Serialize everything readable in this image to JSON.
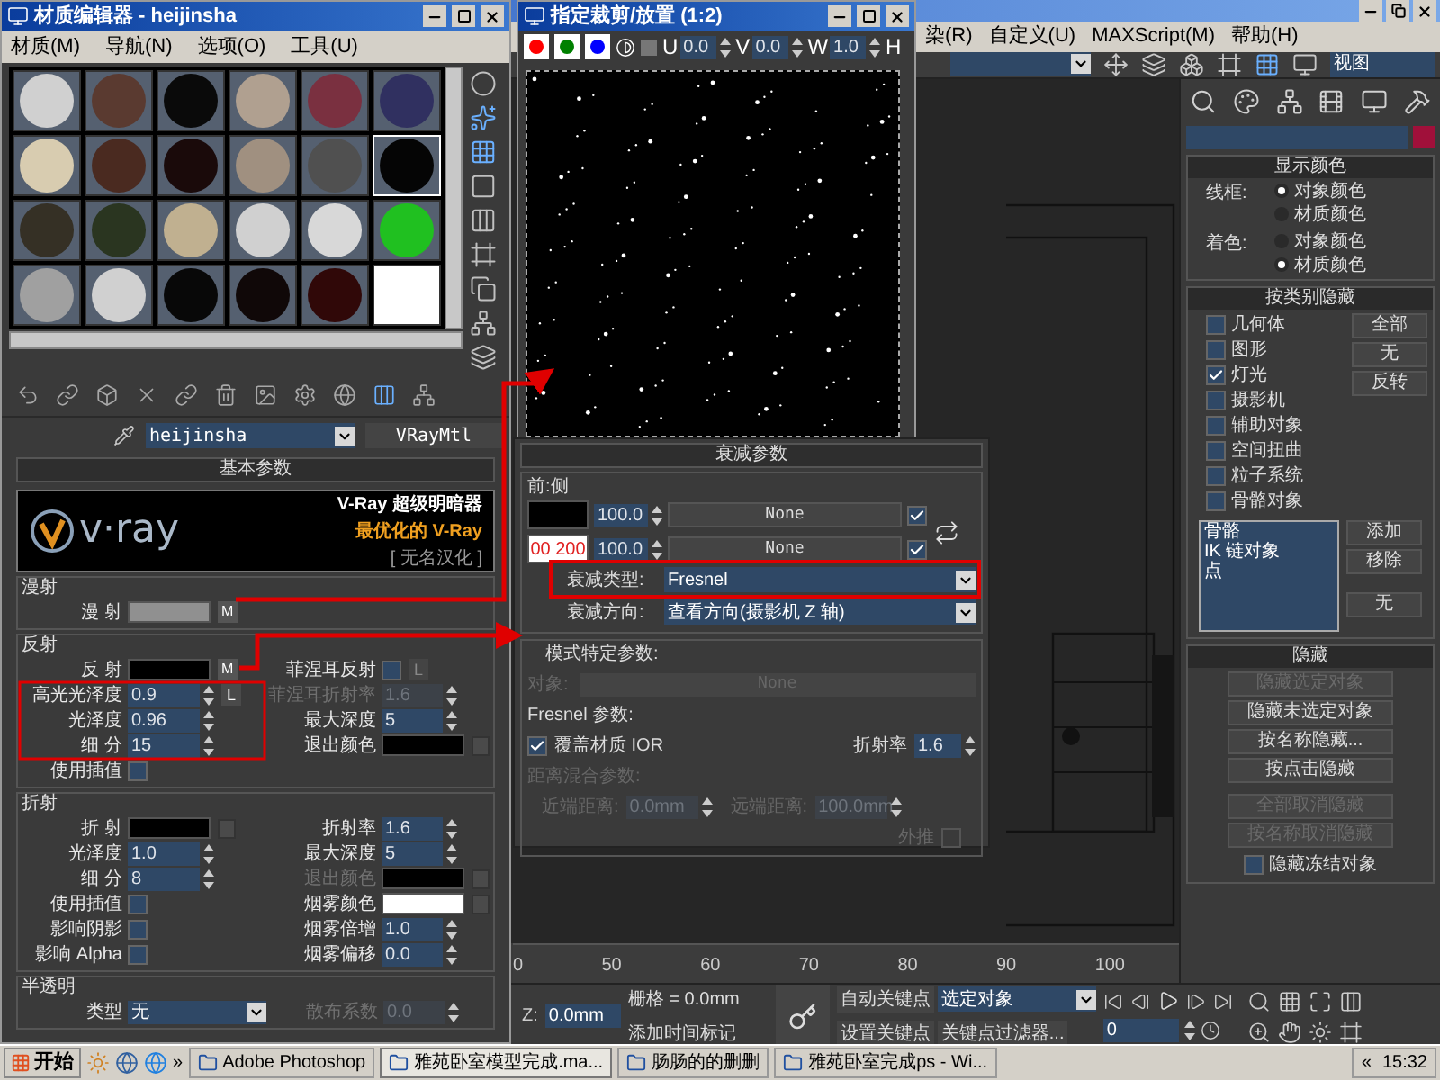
{
  "main_window": {
    "menu": [
      {
        "label": "染(R)"
      },
      {
        "label": "自定义(U)"
      },
      {
        "label": "MAXScript(M)"
      },
      {
        "label": "帮助(H)"
      }
    ],
    "view_selector": "视图",
    "timeline_ticks": [
      "0",
      "50",
      "60",
      "70",
      "80",
      "90",
      "100"
    ],
    "status": {
      "z_label": "Z:",
      "z_value": "0.0mm",
      "grid": "栅格 = 0.0mm",
      "add_time_tag": "添加时间标记",
      "auto_key": "自动关键点",
      "key_mode": "选定对象",
      "set_key": "设置关键点",
      "key_filters": "关键点过滤器...",
      "frame": "0"
    }
  },
  "command_panel": {
    "object_swatch": {
      "color": "#a0103a"
    },
    "display_color": {
      "title": "显示颜色",
      "groups": [
        {
          "label": "线框:",
          "options": [
            {
              "label": "对象颜色",
              "selected": true
            },
            {
              "label": "材质颜色",
              "selected": false
            }
          ]
        },
        {
          "label": "着色:",
          "options": [
            {
              "label": "对象颜色",
              "selected": false
            },
            {
              "label": "材质颜色",
              "selected": true
            }
          ]
        }
      ]
    },
    "hide_by_category": {
      "title": "按类别隐藏",
      "categories": [
        {
          "label": "几何体",
          "checked": false
        },
        {
          "label": "图形",
          "checked": false
        },
        {
          "label": "灯光",
          "checked": true
        },
        {
          "label": "摄影机",
          "checked": false
        },
        {
          "label": "辅助对象",
          "checked": false
        },
        {
          "label": "空间扭曲",
          "checked": false
        },
        {
          "label": "粒子系统",
          "checked": false
        },
        {
          "label": "骨骼对象",
          "checked": false
        }
      ],
      "buttons": [
        "全部",
        "无",
        "反转"
      ],
      "list": [
        "骨骼",
        "IK 链对象",
        "点"
      ],
      "list_buttons": [
        "添加",
        "移除",
        "无"
      ]
    },
    "hide": {
      "title": "隐藏",
      "buttons": [
        {
          "label": "隐藏选定对象",
          "disabled": true
        },
        {
          "label": "隐藏未选定对象",
          "disabled": false
        },
        {
          "label": "按名称隐藏...",
          "disabled": false
        },
        {
          "label": "按点击隐藏",
          "disabled": false
        },
        {
          "label": "全部取消隐藏",
          "disabled": true
        },
        {
          "label": "按名称取消隐藏",
          "disabled": true
        }
      ],
      "freeze_option": {
        "label": "隐藏冻结对象",
        "checked": false
      }
    }
  },
  "material_editor": {
    "title": "材质编辑器 - heijinsha",
    "menu": [
      "材质(M)",
      "导航(N)",
      "选项(O)",
      "工具(U)"
    ],
    "slots": [
      {
        "kind": "sphere",
        "color": "#d0d0d0",
        "selected": false
      },
      {
        "kind": "sphere",
        "color": "#5a3a30",
        "selected": false
      },
      {
        "kind": "sphere",
        "color": "#0a0a0a",
        "selected": false
      },
      {
        "kind": "sphere",
        "color": "#b0a090",
        "selected": false
      },
      {
        "kind": "sphere",
        "color": "#7a3040",
        "selected": false
      },
      {
        "kind": "sphere",
        "color": "#303060",
        "selected": false
      },
      {
        "kind": "sphere",
        "color": "#d8ccb0",
        "selected": false
      },
      {
        "kind": "sphere",
        "color": "#4a2a20",
        "selected": false
      },
      {
        "kind": "sphere",
        "color": "#1a0a0a",
        "selected": false
      },
      {
        "kind": "sphere",
        "color": "#a09080",
        "selected": false
      },
      {
        "kind": "sphere",
        "color": "#505050",
        "selected": false
      },
      {
        "kind": "sphere",
        "color": "#050505",
        "selected": true
      },
      {
        "kind": "sphere",
        "color": "#353025",
        "selected": false
      },
      {
        "kind": "sphere",
        "color": "#2a3520",
        "selected": false
      },
      {
        "kind": "sphere",
        "color": "#c0b090",
        "selected": false
      },
      {
        "kind": "sphere",
        "color": "#d0d0d0",
        "selected": false
      },
      {
        "kind": "sphere",
        "color": "#d8d8d8",
        "selected": false
      },
      {
        "kind": "sphere",
        "color": "#20c020",
        "selected": false
      },
      {
        "kind": "sphere",
        "color": "#a0a0a0",
        "selected": false
      },
      {
        "kind": "sphere",
        "color": "#d0d0d0",
        "selected": false
      },
      {
        "kind": "sphere",
        "color": "#080808",
        "selected": false
      },
      {
        "kind": "sphere",
        "color": "#100808",
        "selected": false
      },
      {
        "kind": "sphere",
        "color": "#300808",
        "selected": false
      },
      {
        "kind": "blank",
        "color": "#ffffff",
        "selected": false
      }
    ],
    "material_name": "heijinsha",
    "material_type": "VRayMtl",
    "rollout": "基本参数",
    "banner": {
      "logo": "v·ray",
      "line1": "V-Ray 超级明暗器",
      "line2": "最优化的 V-Ray",
      "line3": "[ 无名汉化 ]"
    },
    "sections": [
      {
        "title": "漫射",
        "left": [
          {
            "kind": "color",
            "label": "漫 射",
            "color": "#909090",
            "map": "M",
            "disabled": false
          }
        ]
      },
      {
        "title": "反射",
        "left": [
          {
            "kind": "color",
            "label": "反 射",
            "color": "#000000",
            "map": "M",
            "disabled": false
          },
          {
            "kind": "spinner",
            "label": "高光光泽度",
            "value": "0.9",
            "lock": "L",
            "disabled": false
          },
          {
            "kind": "spinner",
            "label": "光泽度",
            "value": "0.96",
            "disabled": false
          },
          {
            "kind": "spinner",
            "label": "细 分",
            "value": "15",
            "disabled": false
          },
          {
            "kind": "checkbox",
            "label": "使用插值",
            "checked": false,
            "disabled": false
          }
        ],
        "right": [
          {
            "kind": "checkbox",
            "label": "菲涅耳反射",
            "checked": false,
            "lock": "L",
            "disabled": false
          },
          {
            "kind": "spinner",
            "label": "菲涅耳折射率",
            "value": "1.6",
            "disabled": true
          },
          {
            "kind": "spinner",
            "label": "最大深度",
            "value": "5",
            "disabled": false
          },
          {
            "kind": "color",
            "label": "退出颜色",
            "color": "#000000",
            "disabled": false
          }
        ]
      },
      {
        "title": "折射",
        "left": [
          {
            "kind": "color",
            "label": "折 射",
            "color": "#000000",
            "disabled": false
          },
          {
            "kind": "spinner",
            "label": "光泽度",
            "value": "1.0",
            "disabled": false
          },
          {
            "kind": "spinner",
            "label": "细 分",
            "value": "8",
            "disabled": false
          },
          {
            "kind": "checkbox",
            "label": "使用插值",
            "checked": false,
            "disabled": false
          },
          {
            "kind": "checkbox",
            "label": "影响阴影",
            "checked": false,
            "disabled": false
          },
          {
            "kind": "checkbox",
            "label": "影响 Alpha",
            "checked": false,
            "disabled": false
          }
        ],
        "right": [
          {
            "kind": "spinner",
            "label": "折射率",
            "value": "1.6",
            "disabled": false
          },
          {
            "kind": "spinner",
            "label": "最大深度",
            "value": "5",
            "disabled": false
          },
          {
            "kind": "color",
            "label": "退出颜色",
            "color": "#000000",
            "disabled": true
          },
          {
            "kind": "color",
            "label": "烟雾颜色",
            "color": "#ffffff",
            "disabled": false
          },
          {
            "kind": "spinner",
            "label": "烟雾倍增",
            "value": "1.0",
            "disabled": false
          },
          {
            "kind": "spinner",
            "label": "烟雾偏移",
            "value": "0.0",
            "disabled": false
          }
        ]
      },
      {
        "title": "半透明",
        "left": [
          {
            "kind": "dropdown",
            "label": "类型",
            "value": "无",
            "disabled": false
          }
        ],
        "right": [
          {
            "kind": "spinner",
            "label": "散布系数",
            "value": "0.0",
            "disabled": true
          }
        ]
      }
    ]
  },
  "crop_window": {
    "title": "指定裁剪/放置 (1:2)",
    "channels": [
      {
        "color": "#ff0000"
      },
      {
        "color": "#008000"
      },
      {
        "color": "#0000ff"
      }
    ],
    "fields": [
      {
        "label": "U",
        "value": "0.0"
      },
      {
        "label": "V",
        "value": "0.0"
      },
      {
        "label": "W",
        "value": "1.0"
      },
      {
        "label": "H"
      }
    ]
  },
  "falloff": {
    "title": "衰减参数",
    "group": "前:侧",
    "rows": [
      {
        "color": "#000000",
        "amount": "100.0",
        "map": "None",
        "checked": true
      },
      {
        "color": "#ffffff",
        "overlay": "00 200",
        "amount": "100.0",
        "map": "None",
        "checked": true
      }
    ],
    "falloff_type": {
      "label": "衰减类型:",
      "value": "Fresnel"
    },
    "falloff_direction": {
      "label": "衰减方向:",
      "value": "查看方向(摄影机 Z 轴)"
    },
    "mode": {
      "title": "模式特定参数:",
      "object": {
        "label": "对象:",
        "value": "None",
        "disabled": true
      },
      "fresnel_title": "Fresnel 参数:",
      "override": {
        "label": "覆盖材质 IOR",
        "checked": true
      },
      "ior_label": "折射率",
      "ior": "1.6",
      "distance": {
        "title": "距离混合参数:",
        "disabled": true,
        "near_label": "近端距离:",
        "near": "0.0mm",
        "far_label": "远端距离:",
        "far": "100.0mm",
        "extrapolate": {
          "label": "外推",
          "checked": false
        }
      }
    }
  },
  "taskbar": {
    "start": "开始",
    "more": "»",
    "tasks": [
      {
        "label": "Adobe Photoshop",
        "selected": false
      },
      {
        "label": "雅苑卧室模型完成.ma...",
        "selected": true
      },
      {
        "label": "肠肠的的删删",
        "selected": false
      },
      {
        "label": "雅苑卧室完成ps - Wi...",
        "selected": false
      }
    ],
    "tray_toggle": "«",
    "clock": "15:32"
  }
}
